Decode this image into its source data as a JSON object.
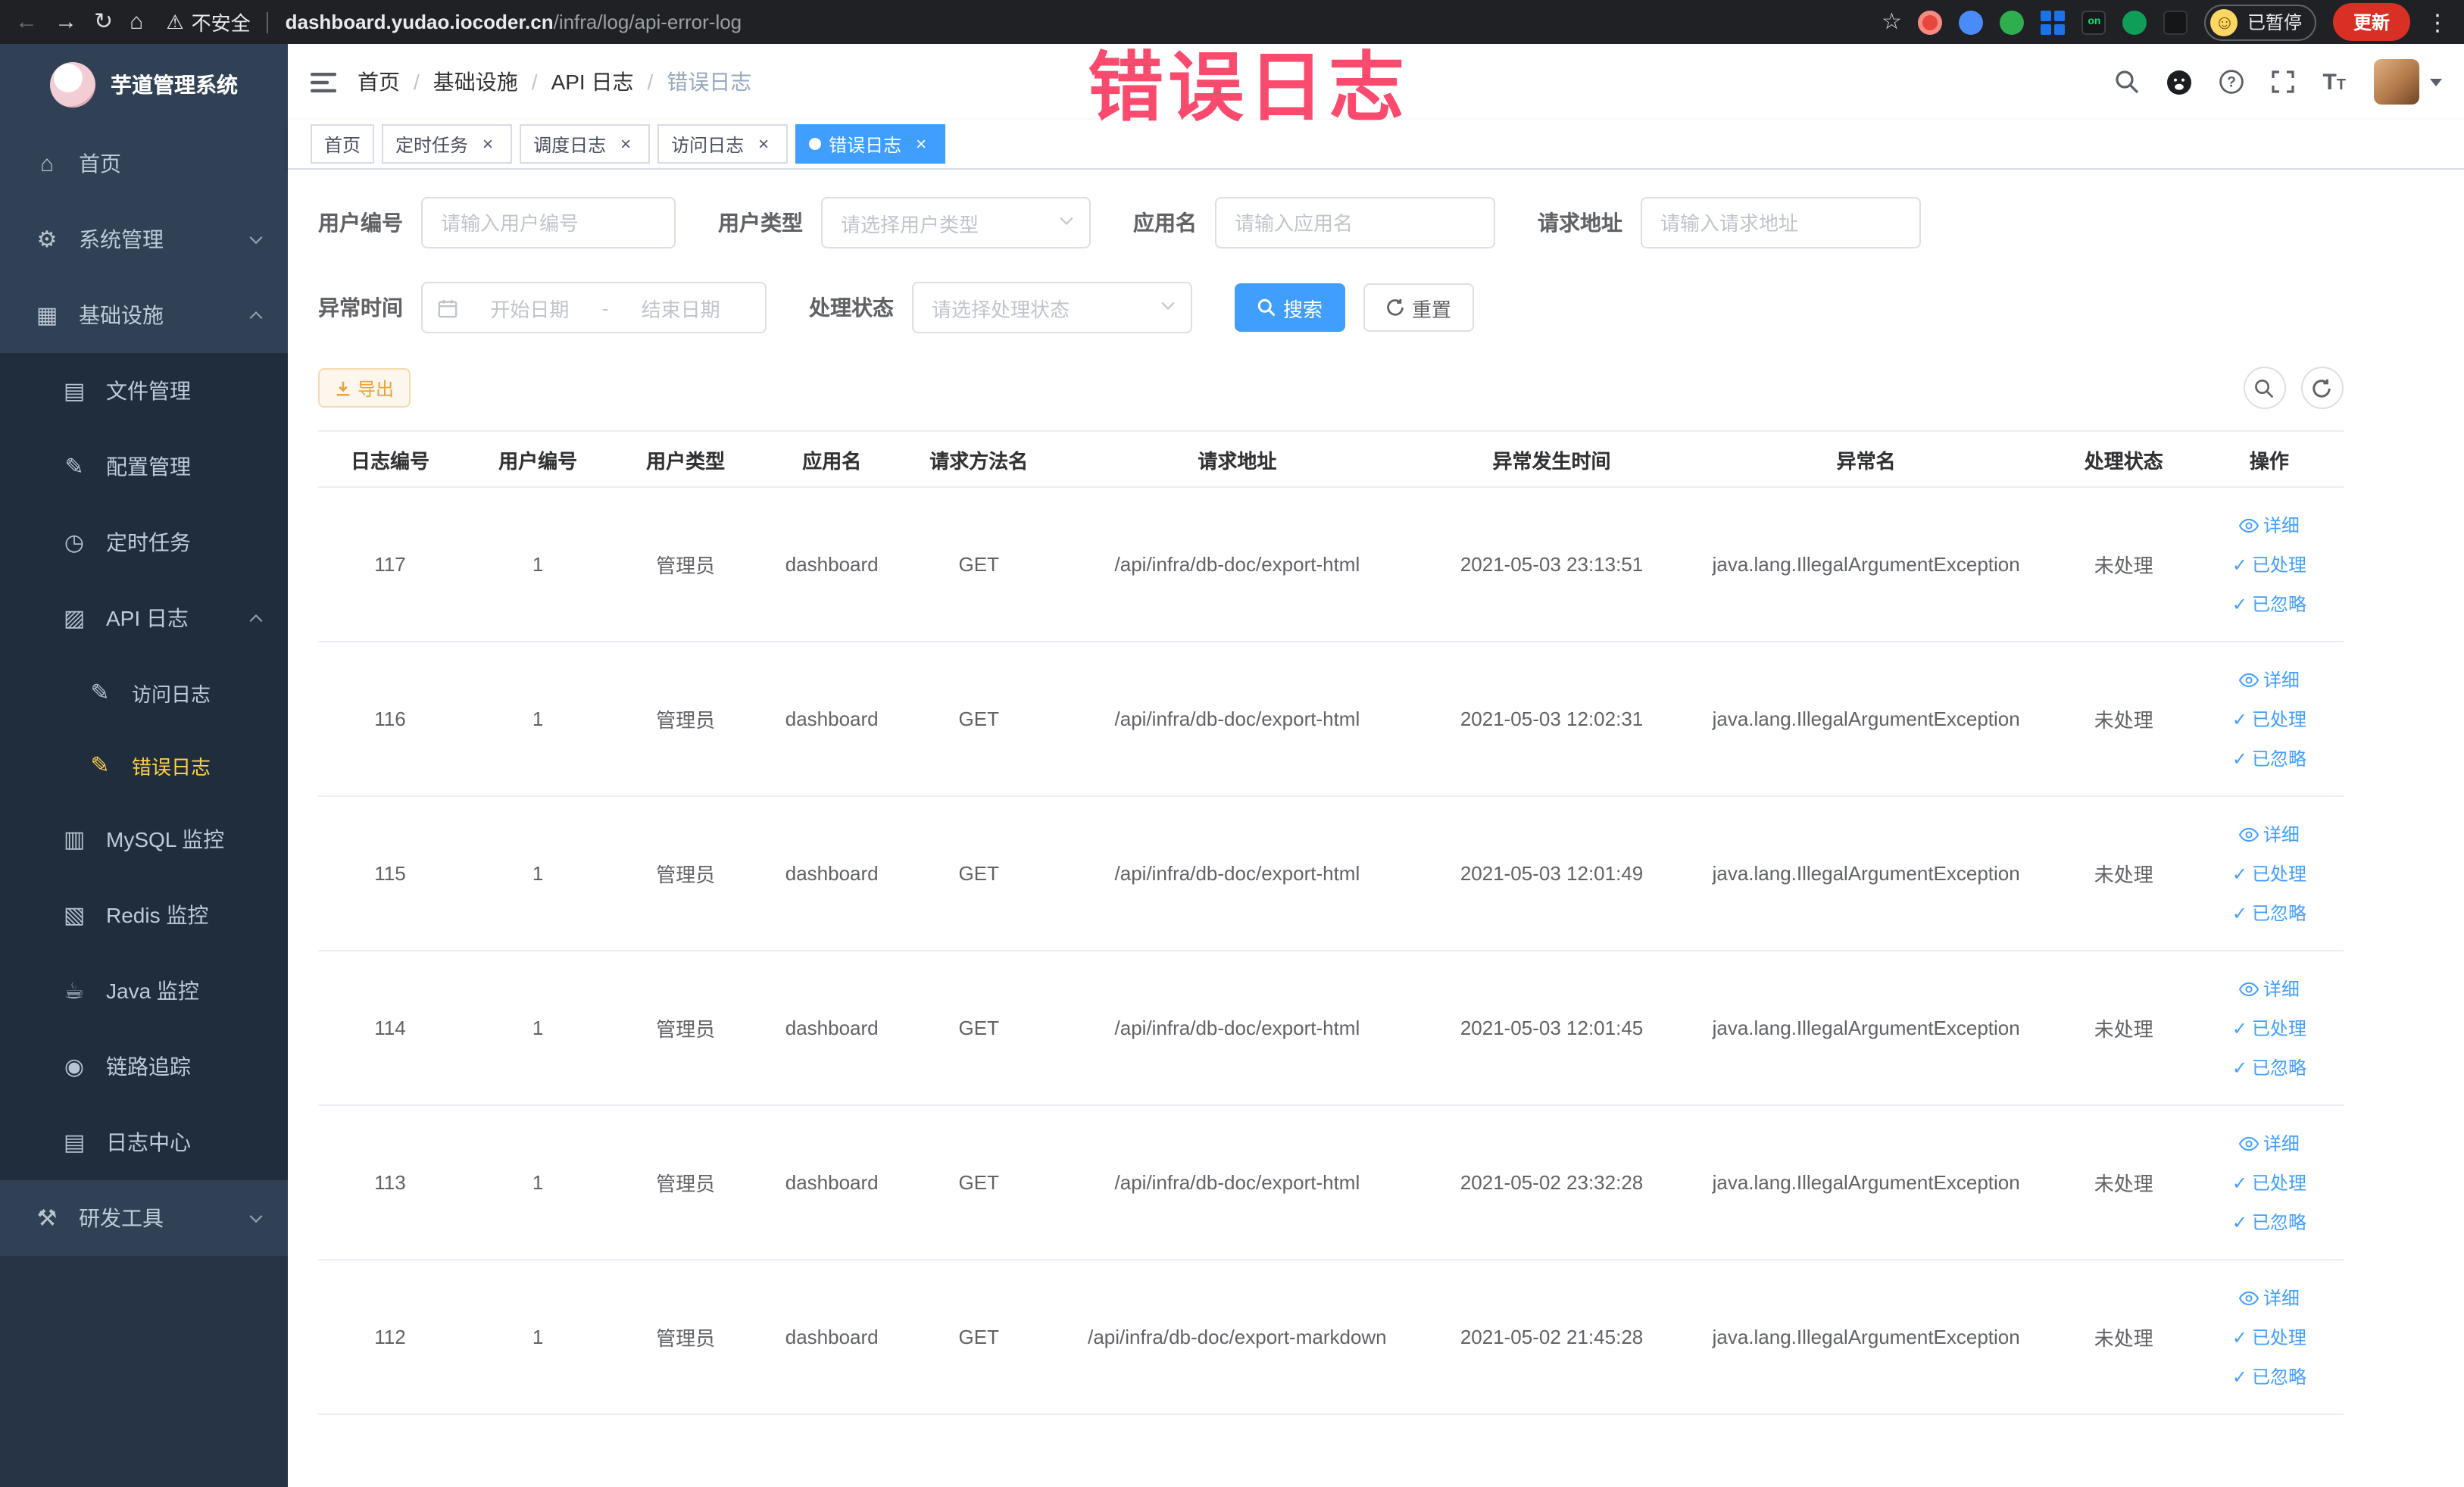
{
  "browser": {
    "security_label": "不安全",
    "url_host": "dashboard.yudao.iocoder.cn",
    "url_path": "/infra/log/api-error-log",
    "extension_on_badge": "on",
    "profile_paused_label": "已暂停",
    "update_label": "更新"
  },
  "overlay_title": "错误日志",
  "sidebar": {
    "logo_title": "芋道管理系统",
    "home": "首页",
    "system": "系统管理",
    "infra": "基础设施",
    "files": "文件管理",
    "config": "配置管理",
    "jobs": "定时任务",
    "api_log": "API 日志",
    "access_log": "访问日志",
    "error_log": "错误日志",
    "mysql": "MySQL 监控",
    "redis": "Redis 监控",
    "java": "Java 监控",
    "trace": "链路追踪",
    "log_center": "日志中心",
    "devtools": "研发工具"
  },
  "breadcrumb": {
    "separator": "/",
    "items": [
      "首页",
      "基础设施",
      "API 日志",
      "错误日志"
    ]
  },
  "tabs": {
    "home": "首页",
    "job": "定时任务",
    "job_log": "调度日志",
    "access_log": "访问日志",
    "error_log": "错误日志"
  },
  "filters": {
    "user_id_label": "用户编号",
    "user_id_placeholder": "请输入用户编号",
    "user_type_label": "用户类型",
    "user_type_placeholder": "请选择用户类型",
    "app_name_label": "应用名",
    "app_name_placeholder": "请输入应用名",
    "request_url_label": "请求地址",
    "request_url_placeholder": "请输入请求地址",
    "exception_time_label": "异常时间",
    "range_start_placeholder": "开始日期",
    "range_separator": "-",
    "range_end_placeholder": "结束日期",
    "process_status_label": "处理状态",
    "process_status_placeholder": "请选择处理状态",
    "search_label": "搜索",
    "reset_label": "重置"
  },
  "toolbar": {
    "export_label": "导出"
  },
  "table": {
    "columns": [
      "日志编号",
      "用户编号",
      "用户类型",
      "应用名",
      "请求方法名",
      "请求地址",
      "异常发生时间",
      "异常名",
      "处理状态",
      "操作"
    ],
    "actions": {
      "detail": "详细",
      "processed": "已处理",
      "ignored": "已忽略"
    },
    "rows": [
      {
        "id": "117",
        "user_id": "1",
        "user_type": "管理员",
        "app": "dashboard",
        "method": "GET",
        "url": "/api/infra/db-doc/export-html",
        "time": "2021-05-03 23:13:51",
        "exception": "java.lang.IllegalArgumentException",
        "status": "未处理"
      },
      {
        "id": "116",
        "user_id": "1",
        "user_type": "管理员",
        "app": "dashboard",
        "method": "GET",
        "url": "/api/infra/db-doc/export-html",
        "time": "2021-05-03 12:02:31",
        "exception": "java.lang.IllegalArgumentException",
        "status": "未处理"
      },
      {
        "id": "115",
        "user_id": "1",
        "user_type": "管理员",
        "app": "dashboard",
        "method": "GET",
        "url": "/api/infra/db-doc/export-html",
        "time": "2021-05-03 12:01:49",
        "exception": "java.lang.IllegalArgumentException",
        "status": "未处理"
      },
      {
        "id": "114",
        "user_id": "1",
        "user_type": "管理员",
        "app": "dashboard",
        "method": "GET",
        "url": "/api/infra/db-doc/export-html",
        "time": "2021-05-03 12:01:45",
        "exception": "java.lang.IllegalArgumentException",
        "status": "未处理"
      },
      {
        "id": "113",
        "user_id": "1",
        "user_type": "管理员",
        "app": "dashboard",
        "method": "GET",
        "url": "/api/infra/db-doc/export-html",
        "time": "2021-05-02 23:32:28",
        "exception": "java.lang.IllegalArgumentException",
        "status": "未处理"
      },
      {
        "id": "112",
        "user_id": "1",
        "user_type": "管理员",
        "app": "dashboard",
        "method": "GET",
        "url": "/api/infra/db-doc/export-markdown",
        "time": "2021-05-02 21:45:28",
        "exception": "java.lang.IllegalArgumentException",
        "status": "未处理"
      }
    ]
  }
}
